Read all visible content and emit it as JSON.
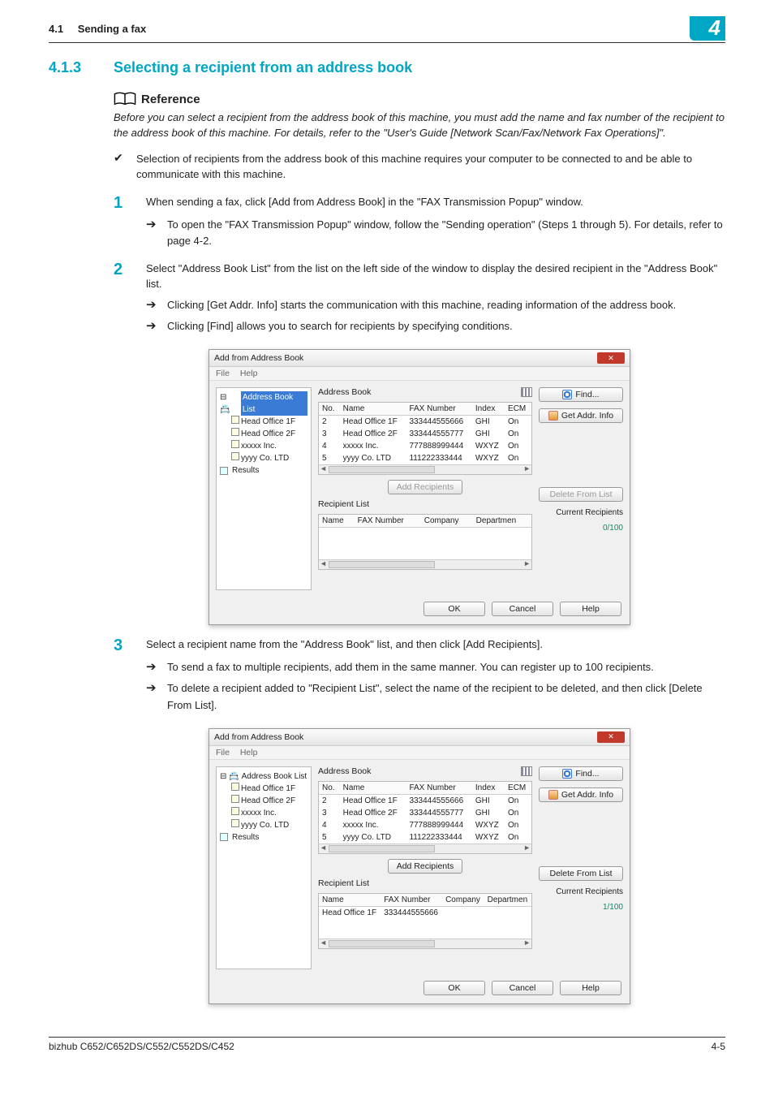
{
  "header": {
    "section": "4.1",
    "title": "Sending a fax",
    "chapter": "4"
  },
  "heading": {
    "number": "4.1.3",
    "title": "Selecting a recipient from an address book"
  },
  "reference": {
    "label": "Reference",
    "text": "Before you can select a recipient from the address book of this machine, you must add the name and fax number of the recipient to the address book of this machine. For details, refer to the \"User's Guide [Network Scan/Fax/Network Fax Operations]\"."
  },
  "check_bullet": "Selection of recipients from the address book of this machine requires your computer to be connected to and be able to communicate with this machine.",
  "steps": {
    "s1": {
      "num": "1",
      "text": "When sending a fax, click [Add from Address Book] in the \"FAX Transmission Popup\" window.",
      "sub1": "To open the \"FAX Transmission Popup\" window, follow the \"Sending operation\" (Steps 1 through 5). For details, refer to page 4-2."
    },
    "s2": {
      "num": "2",
      "text": "Select \"Address Book List\" from the list on the left side of the window to display the desired recipient in the \"Address Book\" list.",
      "sub1": "Clicking [Get Addr. Info] starts the communication with this machine, reading information of the address book.",
      "sub2": "Clicking [Find] allows you to search for recipients by specifying conditions."
    },
    "s3": {
      "num": "3",
      "text": "Select a recipient name from the \"Address Book\" list, and then click [Add Recipients].",
      "sub1": "To send a fax to multiple recipients, add them in the same manner. You can register up to 100 recipients.",
      "sub2": "To delete a recipient added to \"Recipient List\", select the name of the recipient to be deleted, and then click [Delete From List]."
    }
  },
  "dialog": {
    "title": "Add from Address Book",
    "menu_file": "File",
    "menu_help": "Help",
    "tree": {
      "root": "Address Book List",
      "n1": "Head Office 1F",
      "n2": "Head Office 2F",
      "n3": "xxxxx Inc.",
      "n4": "yyyy Co. LTD",
      "results": "Results"
    },
    "address_book_label": "Address Book",
    "recipient_list_label": "Recipient List",
    "headers": {
      "no": "No.",
      "name": "Name",
      "fax": "FAX Number",
      "index": "Index",
      "ecm": "ECM",
      "company": "Company",
      "dept": "Departmen"
    },
    "rows": [
      {
        "no": "2",
        "name": "Head Office 1F",
        "fax": "333444555666",
        "index": "GHI",
        "ecm": "On"
      },
      {
        "no": "3",
        "name": "Head Office 2F",
        "fax": "333444555777",
        "index": "GHI",
        "ecm": "On"
      },
      {
        "no": "4",
        "name": "xxxxx Inc.",
        "fax": "777888999444",
        "index": "WXYZ",
        "ecm": "On"
      },
      {
        "no": "5",
        "name": "yyyy Co. LTD",
        "fax": "111222333444",
        "index": "WXYZ",
        "ecm": "On"
      }
    ],
    "recipient_row": {
      "name": "Head Office 1F",
      "fax": "333444555666"
    },
    "btn_find": "Find...",
    "btn_get": "Get Addr. Info",
    "btn_add": "Add Recipients",
    "btn_delete": "Delete From List",
    "cr_label": "Current Recipients",
    "cr_count0": "0/100",
    "cr_count1": "1/100",
    "btn_ok": "OK",
    "btn_cancel": "Cancel",
    "btn_help": "Help"
  },
  "footer": {
    "left": "bizhub C652/C652DS/C552/C552DS/C452",
    "right": "4-5"
  }
}
